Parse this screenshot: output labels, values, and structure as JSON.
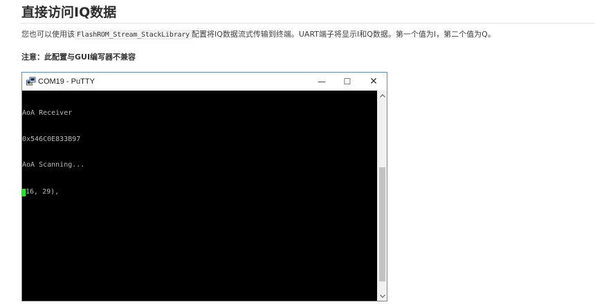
{
  "page": {
    "title": "直接访问IQ数据",
    "paragraph_before": "您也可以使用该",
    "paragraph_code": "FlashROM_Stream_StackLibrary",
    "paragraph_after": "配置将IQ数据流式传输到终端。UART端子将显示I和Q数据。第一个值为I，第二个值为Q。",
    "note": "注意：此配置与GUI编写器不兼容"
  },
  "window": {
    "title": "COM19 - PuTTY",
    "icons": {
      "app": "putty-icon",
      "minimize": "minimize-icon",
      "maximize": "maximize-icon",
      "close": "close-icon",
      "scroll_up": "chevron-up-icon",
      "scroll_down": "chevron-down-icon"
    },
    "controls": {
      "minimize": "—",
      "maximize": "☐",
      "close": "✕"
    }
  },
  "terminal": {
    "lines": [
      "AoA Receiver",
      "0x546C0E833B97",
      "AoA Scanning..."
    ],
    "current_line": "16, 29),",
    "cursor_char": "(",
    "colors": {
      "background": "#000000",
      "text": "#bbbbbb",
      "cursor": "#00ff00"
    }
  },
  "scroll": {
    "thumb_start_fraction": 0.35,
    "thumb_size_fraction": 0.6
  }
}
